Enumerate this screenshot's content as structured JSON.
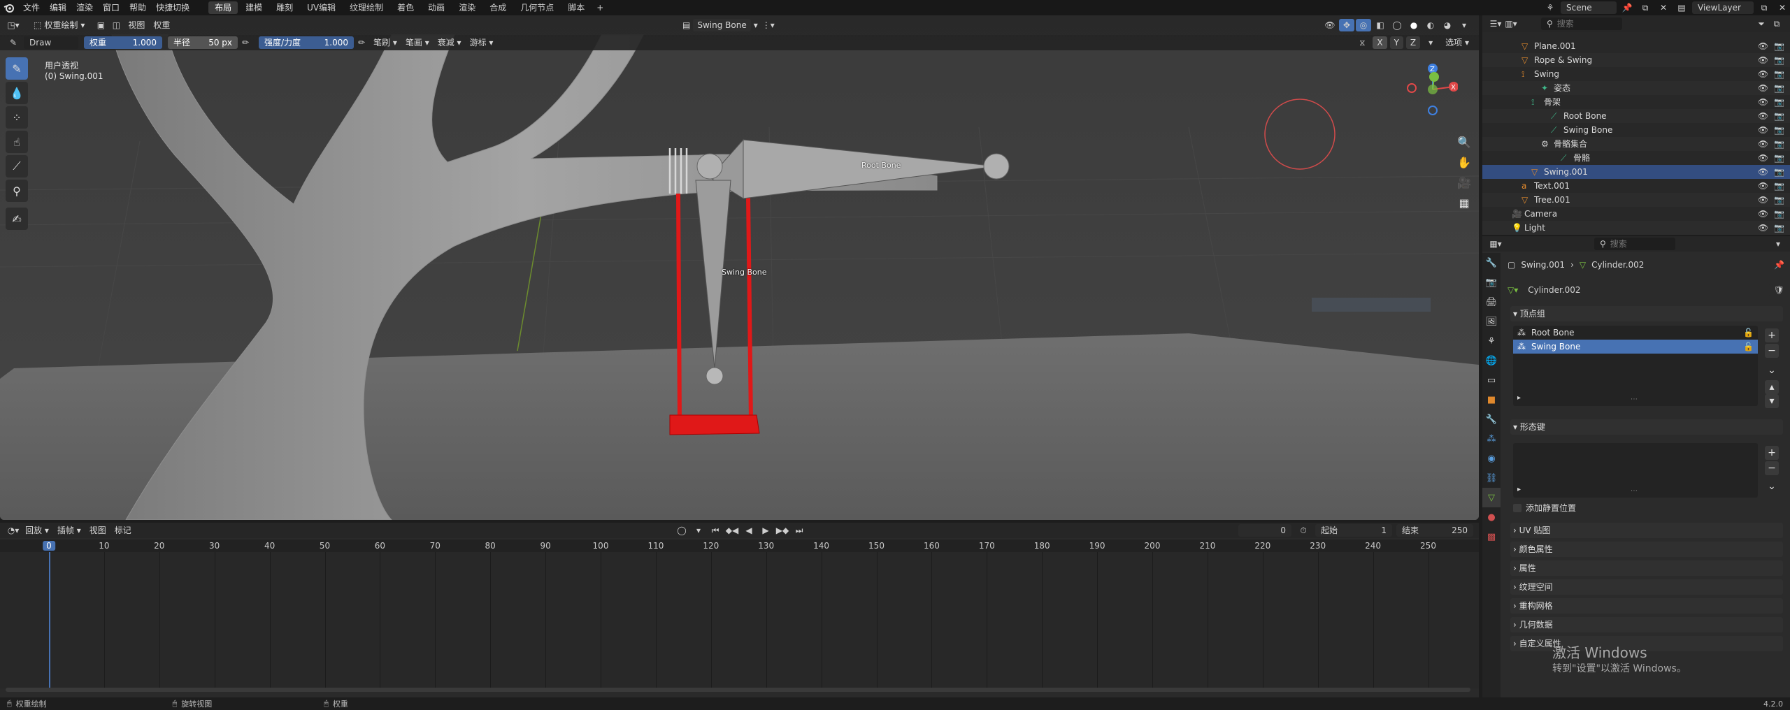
{
  "menu": [
    "文件",
    "编辑",
    "渲染",
    "窗口",
    "帮助",
    "快捷切换"
  ],
  "workspaces": [
    "布局",
    "建模",
    "雕刻",
    "UV编辑",
    "纹理绘制",
    "着色",
    "动画",
    "渲染",
    "合成",
    "几何节点",
    "脚本"
  ],
  "active_workspace": "布局",
  "scene": {
    "name": "Scene",
    "view_layer": "ViewLayer"
  },
  "viewport": {
    "mode": "权重绘制",
    "menus": [
      "视图",
      "权重"
    ],
    "armature_field": "Swing Bone",
    "tool": {
      "name": "Draw",
      "weight_label": "权重",
      "weight_value": "1.000",
      "radius_label": "半径",
      "radius_value": "50 px",
      "strength_label": "强度/力度",
      "strength_value": "1.000",
      "dropdowns": [
        "笔刷",
        "笔画",
        "衰减",
        "游标"
      ]
    },
    "options": "选项",
    "axis_labels": [
      "X",
      "Y",
      "Z"
    ],
    "view_name": "用户透视",
    "object_name": "(0) Swing.001",
    "bone_labels": [
      "Root Bone",
      "Swing Bone"
    ]
  },
  "timeline": {
    "menus": [
      "回放",
      "插帧",
      "视图",
      "标记"
    ],
    "current_frame": "0",
    "start_label": "起始",
    "start": "1",
    "end_label": "结束",
    "end": "250",
    "ticks": [
      "0",
      "10",
      "20",
      "30",
      "40",
      "50",
      "60",
      "70",
      "80",
      "90",
      "100",
      "110",
      "120",
      "130",
      "140",
      "150",
      "160",
      "170",
      "180",
      "190",
      "200",
      "210",
      "220",
      "230",
      "240",
      "250"
    ]
  },
  "status": {
    "left": "权重绘制",
    "middle": "旋转视图",
    "right": "权重",
    "version": "4.2.0"
  },
  "outliner": {
    "search_placeholder": "搜索",
    "rows": [
      {
        "label": "Plane.001",
        "indent": 3,
        "icon": "mesh-icon"
      },
      {
        "label": "Rope & Swing",
        "indent": 3,
        "icon": "mesh-icon"
      },
      {
        "label": "Swing",
        "indent": 3,
        "icon": "armature-icon"
      },
      {
        "label": "姿态",
        "indent": 5,
        "icon": "pose-icon"
      },
      {
        "label": "骨架",
        "indent": 4,
        "icon": "armature-data-icon"
      },
      {
        "label": "Root Bone",
        "indent": 6,
        "icon": "bone-icon"
      },
      {
        "label": "Swing Bone",
        "indent": 6,
        "icon": "bone-icon"
      },
      {
        "label": "骨骼集合",
        "indent": 5,
        "icon": "bone-collection-icon"
      },
      {
        "label": "骨骼",
        "indent": 7,
        "icon": "bone-icon"
      },
      {
        "label": "Swing.001",
        "indent": 4,
        "icon": "mesh-icon",
        "selected": true
      },
      {
        "label": "Text.001",
        "indent": 3,
        "icon": "text-icon"
      },
      {
        "label": "Tree.001",
        "indent": 3,
        "icon": "mesh-icon"
      },
      {
        "label": "Camera",
        "indent": 2,
        "icon": "camera-icon"
      },
      {
        "label": "Light",
        "indent": 2,
        "icon": "light-icon"
      }
    ]
  },
  "properties": {
    "search_placeholder": "搜索",
    "breadcrumb": [
      "Swing.001",
      "Cylinder.002"
    ],
    "data_name": "Cylinder.002",
    "vertex_groups_title": "顶点组",
    "vertex_groups": [
      "Root Bone",
      "Swing Bone"
    ],
    "shape_keys_title": "形态键",
    "add_rest_position": "添加静置位置",
    "panels": [
      "UV 贴图",
      "颜色属性",
      "属性",
      "纹理空间",
      "重构网格",
      "几何数据",
      "自定义属性"
    ]
  },
  "watermark": {
    "title": "激活 Windows",
    "subtitle": "转到\"设置\"以激活 Windows。"
  },
  "colors": {
    "accent": "#4772b3",
    "selection": "#334d80",
    "rope": "#e01818",
    "gizmo_x": "#e04848",
    "gizmo_y": "#7ac042",
    "gizmo_z": "#3f80e0"
  }
}
